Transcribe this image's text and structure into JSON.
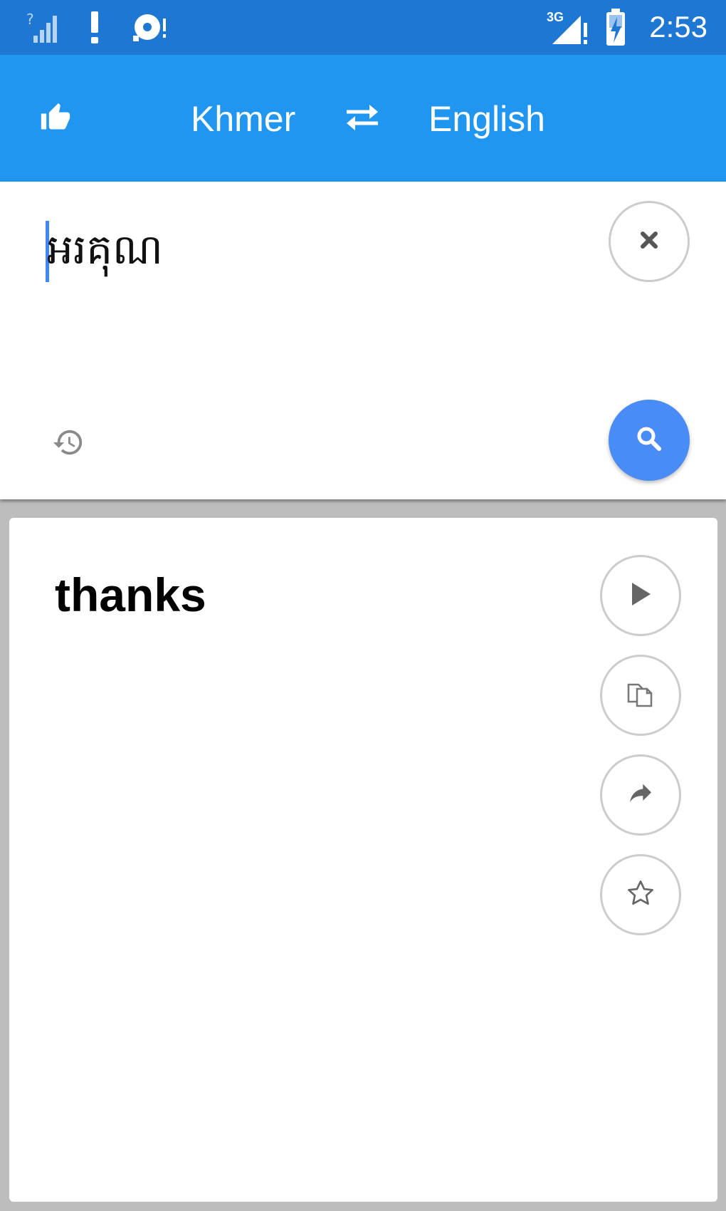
{
  "status_bar": {
    "time": "2:53",
    "network_label": "3G",
    "icons": [
      "signal-unknown-icon",
      "alert-icon",
      "sync-alert-icon",
      "network-3g-icon",
      "battery-charging-icon"
    ]
  },
  "header": {
    "source_language": "Khmer",
    "target_language": "English",
    "icons": [
      "thumbs-up-icon",
      "swap-icon"
    ]
  },
  "input": {
    "text": "អរគុណ",
    "icons": [
      "close-icon",
      "history-icon",
      "search-icon"
    ]
  },
  "result": {
    "text": "thanks",
    "actions": [
      "play-icon",
      "copy-icon",
      "share-icon",
      "star-icon"
    ]
  },
  "colors": {
    "status_bar": "#1e78d3",
    "app_bar": "#2196f0",
    "accent": "#4a8cf6",
    "background": "#bdbdbd"
  }
}
